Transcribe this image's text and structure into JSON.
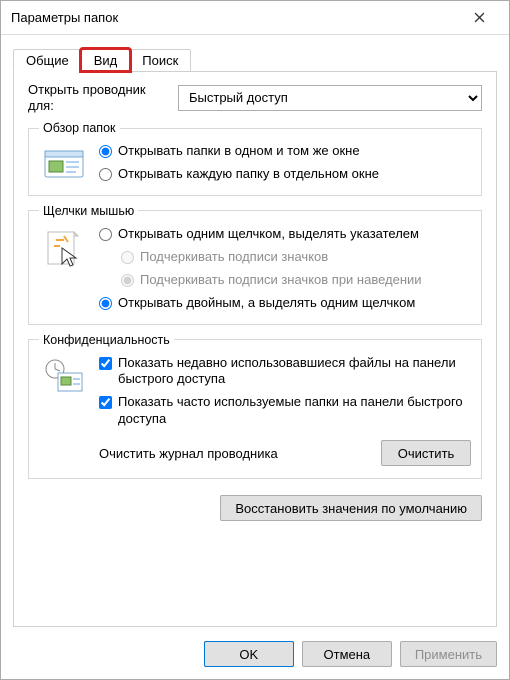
{
  "window": {
    "title": "Параметры папок"
  },
  "tabs": {
    "general": "Общие",
    "view": "Вид",
    "search": "Поиск"
  },
  "openExplorer": {
    "label": "Открыть проводник для:",
    "value": "Быстрый доступ"
  },
  "browseFolders": {
    "legend": "Обзор папок",
    "sameWindow": "Открывать папки в одном и том же окне",
    "newWindow": "Открывать каждую папку в отдельном окне"
  },
  "clickItems": {
    "legend": "Щелчки мышью",
    "singleClick": "Открывать одним щелчком, выделять указателем",
    "underlineAlways": "Подчеркивать подписи значков",
    "underlineHover": "Подчеркивать подписи значков при наведении",
    "doubleClick": "Открывать двойным, а выделять одним щелчком"
  },
  "privacy": {
    "legend": "Конфиденциальность",
    "recentFiles": "Показать недавно использовавшиеся файлы на панели быстрого доступа",
    "frequentFolders": "Показать часто используемые папки на панели быстрого доступа",
    "clearLabel": "Очистить журнал проводника",
    "clearButton": "Очистить"
  },
  "restoreDefaults": "Восстановить значения по умолчанию",
  "buttons": {
    "ok": "OK",
    "cancel": "Отмена",
    "apply": "Применить"
  }
}
